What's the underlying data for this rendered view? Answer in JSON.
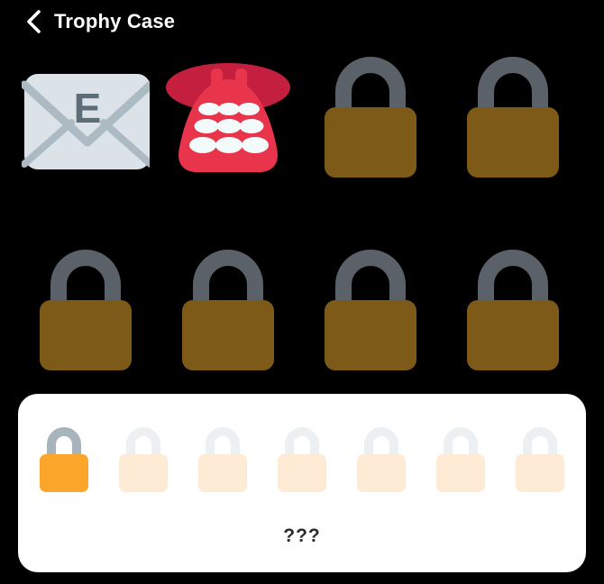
{
  "window": {
    "background_color": "#000000"
  },
  "header": {
    "back_icon": "chevron-left-icon",
    "title": "Trophy Case"
  },
  "colors": {
    "locked_body": "#7D5A17",
    "locked_shackle": "#5A6169",
    "active_lock_body": "#FCA52B",
    "active_lock_shackle": "#A8B4BC",
    "faded_lock_body": "#FDEBD5",
    "faded_lock_shackle": "#ECF0F2",
    "envelope_face": "#DCE3E8",
    "envelope_fold": "#ABBAC3",
    "envelope_letter": "#5E6E78",
    "phone_handset": "#C51F3F",
    "phone_body": "#E8354C",
    "phone_buttons": "#F2FAFA",
    "card_background": "#FFFFFF",
    "card_text": "#2B2B2B",
    "title_text": "#FFFFFF"
  },
  "trophies": {
    "rows": [
      [
        {
          "name": "email-trophy",
          "state": "unlocked",
          "icon": "envelope-e-icon",
          "letter": "E"
        },
        {
          "name": "telephone-trophy",
          "state": "unlocked",
          "icon": "telephone-icon"
        },
        {
          "name": "trophy-slot-3",
          "state": "locked",
          "icon": "lock-icon"
        },
        {
          "name": "trophy-slot-4",
          "state": "locked",
          "icon": "lock-icon"
        }
      ],
      [
        {
          "name": "trophy-slot-5",
          "state": "locked",
          "icon": "lock-icon"
        },
        {
          "name": "trophy-slot-6",
          "state": "locked",
          "icon": "lock-icon"
        },
        {
          "name": "trophy-slot-7",
          "state": "locked",
          "icon": "lock-icon"
        },
        {
          "name": "trophy-slot-8",
          "state": "locked",
          "icon": "lock-icon"
        }
      ]
    ]
  },
  "progress_card": {
    "label": "???",
    "locks": [
      {
        "name": "progress-lock-1",
        "state": "active"
      },
      {
        "name": "progress-lock-2",
        "state": "faded"
      },
      {
        "name": "progress-lock-3",
        "state": "faded"
      },
      {
        "name": "progress-lock-4",
        "state": "faded"
      },
      {
        "name": "progress-lock-5",
        "state": "faded"
      },
      {
        "name": "progress-lock-6",
        "state": "faded"
      },
      {
        "name": "progress-lock-7",
        "state": "faded"
      }
    ],
    "active_count": 1,
    "total_count": 7
  }
}
